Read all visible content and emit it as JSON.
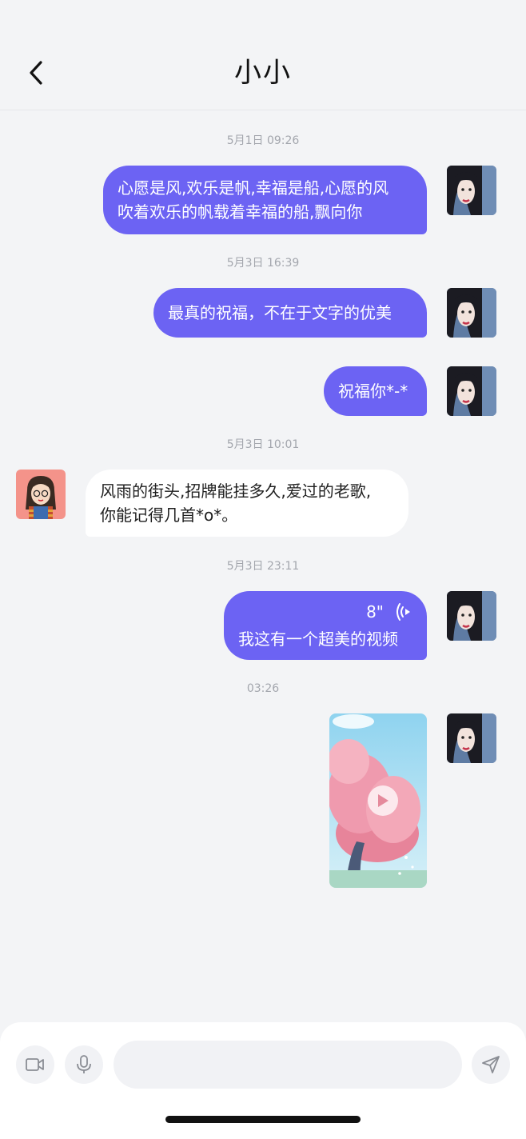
{
  "header": {
    "title": "小小",
    "back_icon": "chevron-left-icon"
  },
  "messages": [
    {
      "time": "5月1日  09:26",
      "direction": "out",
      "lines": [
        "心愿是风,欢乐是帆,幸福是船,心愿的风",
        "吹着欢乐的帆载着幸福的船,飘向你"
      ]
    },
    {
      "time": "5月3日  16:39",
      "direction": "out",
      "lines": [
        "最真的祝福，不在于文字的优美"
      ]
    },
    {
      "time": "",
      "direction": "out",
      "lines": [
        "祝福你*-*"
      ]
    },
    {
      "time": "5月3日  10:01",
      "direction": "in",
      "lines": [
        "风雨的街头,招牌能挂多久,爱过的老歌,",
        "你能记得几首*o*。"
      ]
    },
    {
      "time": "5月3日  23:11",
      "direction": "out",
      "voice_duration": "8\"",
      "lines": [
        "我这有一个超美的视频"
      ]
    },
    {
      "time": "03:26",
      "direction": "out",
      "type": "video"
    }
  ],
  "input_bar": {
    "video_icon": "video-camera-icon",
    "mic_icon": "microphone-icon",
    "send_icon": "send-icon",
    "placeholder": ""
  },
  "colors": {
    "accent": "#6c63f3",
    "background": "#f3f4f6",
    "incoming_bubble": "#ffffff"
  }
}
